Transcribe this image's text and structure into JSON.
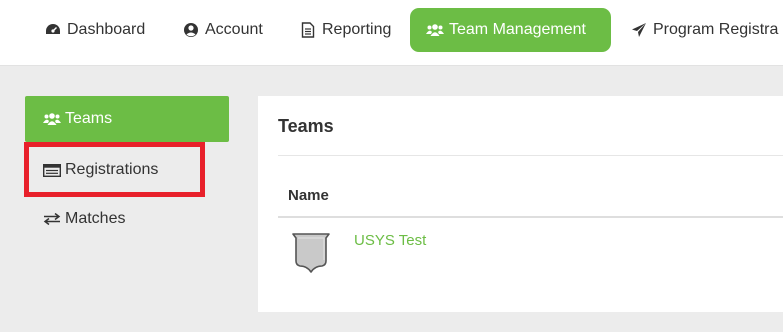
{
  "topnav": {
    "items": [
      {
        "label": "Dashboard",
        "icon": "dashboard-gauge-icon",
        "active": false
      },
      {
        "label": "Account",
        "icon": "user-circle-icon",
        "active": false
      },
      {
        "label": "Reporting",
        "icon": "document-icon",
        "active": false
      },
      {
        "label": "Team Management",
        "icon": "users-icon",
        "active": true
      },
      {
        "label": "Program Registra",
        "icon": "paper-plane-icon",
        "active": false
      }
    ]
  },
  "sidebar": {
    "items": [
      {
        "label": "Teams",
        "icon": "users-icon",
        "active": true
      },
      {
        "label": "Registrations",
        "icon": "list-table-icon",
        "active": false,
        "highlighted": true
      },
      {
        "label": "Matches",
        "icon": "exchange-arrows-icon",
        "active": false
      }
    ]
  },
  "panel": {
    "title": "Teams",
    "columns": [
      "Name"
    ],
    "rows": [
      {
        "name": "USYS Test",
        "icon": "team-crest-icon"
      }
    ]
  },
  "colors": {
    "accent": "#6cbd45",
    "highlight": "#e8202a",
    "content_background": "#ececec"
  }
}
